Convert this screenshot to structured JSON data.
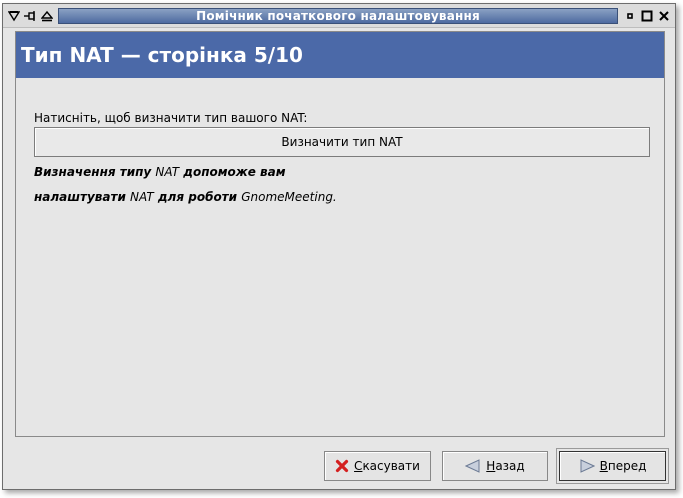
{
  "window": {
    "title": "Помічник початкового налаштовування"
  },
  "page": {
    "header": "Тип NAT — сторінка 5/10",
    "prompt": "Натисніть, щоб визначити тип вашого NAT:",
    "detect_button": "Визначити тип NAT",
    "desc_line1_part1": "Визначення типу ",
    "desc_line1_part2": "NAT",
    "desc_line1_part3": " допоможе вам",
    "desc_line2_part1": "налаштувати ",
    "desc_line2_part2": "NAT",
    "desc_line2_part3": " для роботи ",
    "desc_line2_part4": "GnomeMeeting."
  },
  "buttons": {
    "cancel_mnemonic": "С",
    "cancel_rest": "касувати",
    "back_mnemonic": "Н",
    "back_rest": "азад",
    "forward_mnemonic": "В",
    "forward_rest": "перед"
  },
  "colors": {
    "header_band": "#4b69a8",
    "title_gradient_top": "#8aa1c3",
    "title_gradient_bottom": "#4e6aa0"
  },
  "icons": {
    "titlebar_menu": "menu-triangle-icon",
    "titlebar_pin": "pin-icon",
    "titlebar_shade": "shade-icon",
    "titlebar_iconify": "iconify-icon",
    "titlebar_maximize": "maximize-icon",
    "titlebar_close": "close-icon",
    "cancel": "red-x-icon",
    "back": "left-arrow-icon",
    "forward": "right-arrow-icon"
  }
}
